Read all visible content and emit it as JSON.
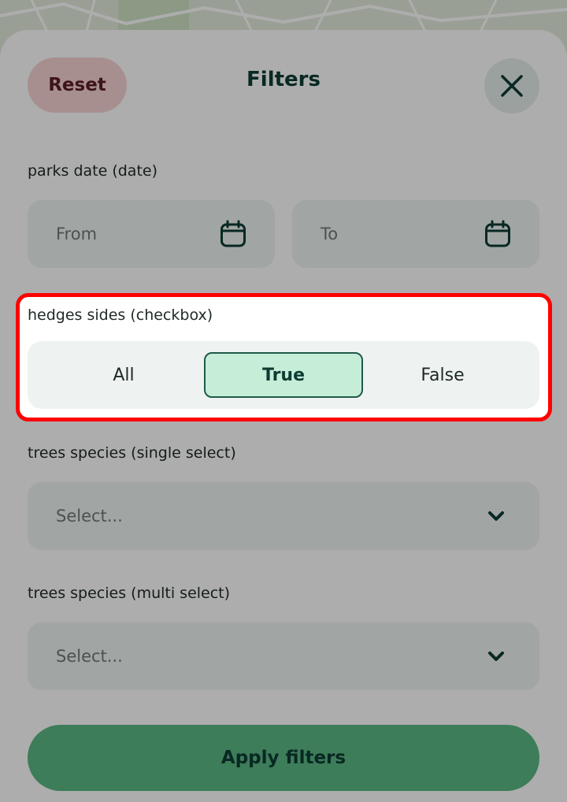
{
  "header": {
    "reset_label": "Reset",
    "title": "Filters"
  },
  "fields": {
    "date": {
      "label": "parks date (date)",
      "from_placeholder": "From",
      "to_placeholder": "To"
    },
    "checkbox": {
      "label": "hedges sides (checkbox)",
      "options": [
        "All",
        "True",
        "False"
      ],
      "selected": "True"
    },
    "single_select": {
      "label": "trees species (single select)",
      "placeholder": "Select..."
    },
    "multi_select": {
      "label": "trees species (multi select)",
      "placeholder": "Select..."
    }
  },
  "apply_label": "Apply filters",
  "icons": {
    "close": "close-icon",
    "calendar": "calendar-icon",
    "chevron": "chevron-down-icon"
  },
  "colors": {
    "primary": "#5ab883",
    "reset_bg": "#f7d3d3",
    "highlight": "#ff0000",
    "selected_option_bg": "#c6edd7"
  }
}
